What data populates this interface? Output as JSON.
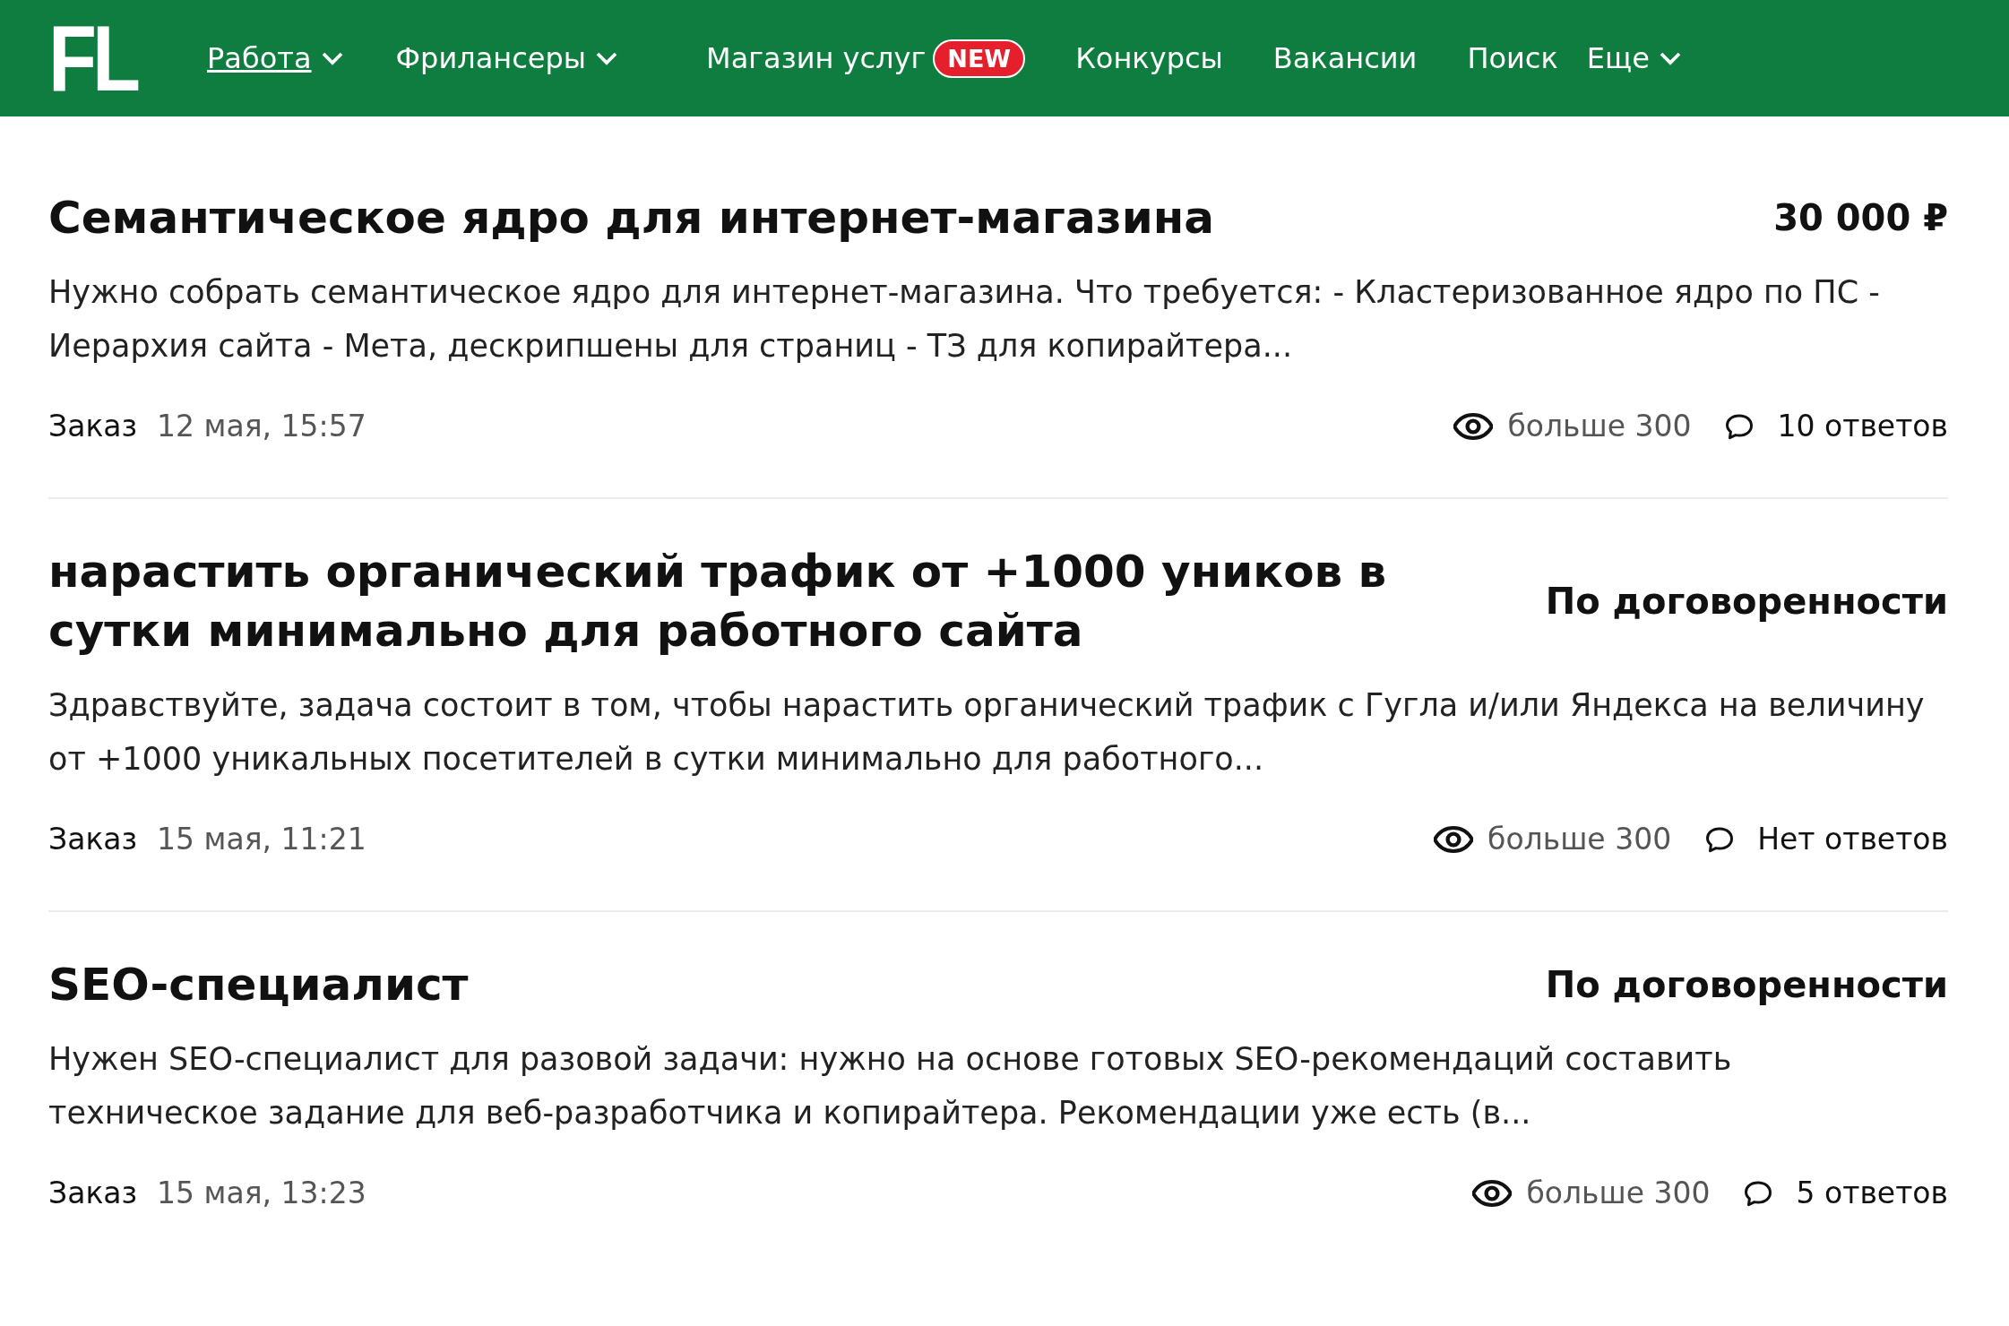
{
  "header": {
    "logo": "FL",
    "nav": [
      {
        "label": "Работа",
        "selected": true,
        "dropdown": true
      },
      {
        "label": "Фрилансеры",
        "selected": false,
        "dropdown": true
      },
      {
        "label": "Магазин услуг",
        "selected": false,
        "dropdown": false,
        "badge": "NEW"
      },
      {
        "label": "Конкурсы",
        "selected": false,
        "dropdown": false
      },
      {
        "label": "Вакансии",
        "selected": false,
        "dropdown": false
      },
      {
        "label": "Поиск",
        "selected": false,
        "dropdown": false
      },
      {
        "label": "Еще",
        "selected": false,
        "dropdown": true
      }
    ]
  },
  "orders": [
    {
      "title": "Семантическое ядро для интернет-магазина",
      "price": "30 000 ₽",
      "description": "Нужно собрать семантическое ядро для интернет-магазина.  Что требуется: - Кластеризованное ядро по ПС - Иерархия сайта - Мета, дескрипшены для страниц - ТЗ для копирайтера...",
      "type": "Заказ",
      "date": "12 мая, 15:57",
      "views": "больше 300",
      "answers": "10 ответов"
    },
    {
      "title": "нарастить органический трафик от +1000 уников в сутки минимально для работного сайта",
      "price": "По договоренности",
      "description": "Здравствуйте, задача состоит в том, чтобы  нарастить органический трафик с Гугла и/или Яндекса на величину от +1000 уникальных посетителей в сутки минимально для работного...",
      "type": "Заказ",
      "date": "15 мая, 11:21",
      "views": "больше 300",
      "answers": "Нет ответов"
    },
    {
      "title": "SEO-специалист",
      "price": "По договоренности",
      "description": "Нужен SEO-специалист для разовой задачи: нужно на основе готовых SEO-рекомендаций составить техническое задание для веб-разработчика и копирайтера. Рекомендации уже есть (в...",
      "type": "Заказ",
      "date": "15 мая, 13:23",
      "views": "больше 300",
      "answers": "5 ответов"
    }
  ]
}
